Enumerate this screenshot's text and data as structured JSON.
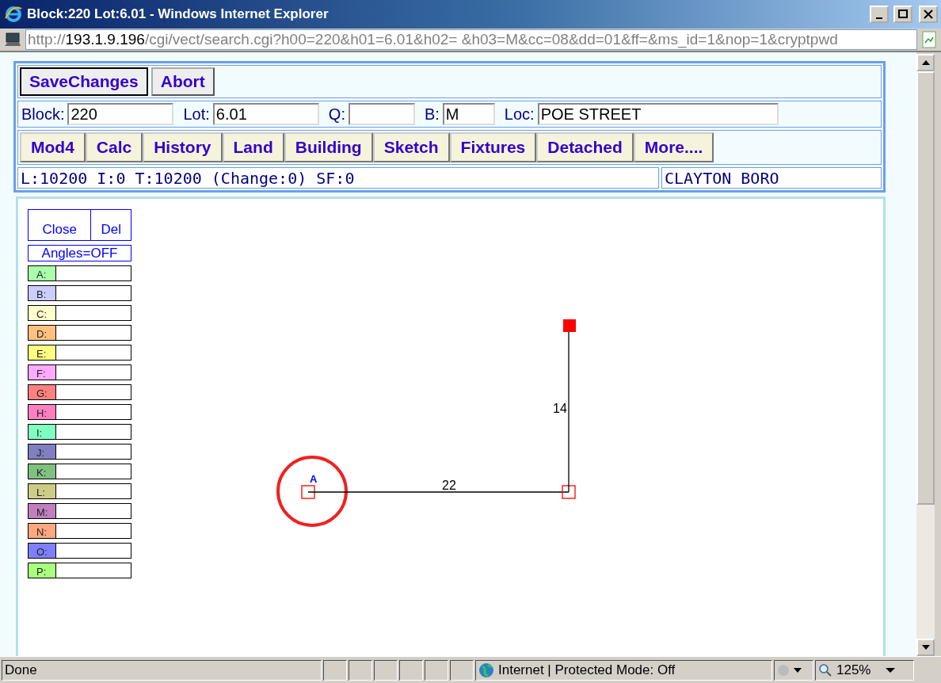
{
  "window": {
    "title": "Block:220 Lot:6.01 - Windows Internet Explorer"
  },
  "address_bar": {
    "scheme": "http://",
    "host": "193.1.9.196",
    "path": "/cgi/vect/search.cgi?h00=220&h01=6.01&h02= &h03=M&cc=08&dd=01&ff=&ms_id=1&nop=1&cryptpwd"
  },
  "action_buttons": [
    "SaveChanges",
    "Abort"
  ],
  "fields": [
    {
      "label": "Block:",
      "value": "220"
    },
    {
      "label": "Lot:",
      "value": "6.01"
    },
    {
      "label": "Q:"
    },
    {
      "label": "B:",
      "value": "M"
    },
    {
      "label": "Loc:",
      "value": "POE STREET"
    }
  ],
  "nav_buttons": [
    "Mod4",
    "Calc",
    "History",
    "Land",
    "Building",
    "Sketch",
    "Fixtures",
    "Detached",
    "More...."
  ],
  "summary": {
    "totals": "L:10200 I:0 T:10200 (Change:0) SF:0",
    "municipality": "CLAYTON BORO"
  },
  "sketch_tools": {
    "buttons": [
      "Close",
      "Del"
    ],
    "angles": "Angles=OFF"
  },
  "areas": [
    {
      "label": "A:",
      "color": "#aaffaa"
    },
    {
      "label": "B:",
      "color": "#ccccff"
    },
    {
      "label": "C:",
      "color": "#ffffcc"
    },
    {
      "label": "D:",
      "color": "#ffc080"
    },
    {
      "label": "E:",
      "color": "#ffff80"
    },
    {
      "label": "F:",
      "color": "#ffaaff"
    },
    {
      "label": "G:",
      "color": "#ff8080"
    },
    {
      "label": "H:",
      "color": "#ff80c0"
    },
    {
      "label": "I:",
      "color": "#80ffc0"
    },
    {
      "label": "J:",
      "color": "#8080c0"
    },
    {
      "label": "K:",
      "color": "#80c080"
    },
    {
      "label": "L:",
      "color": "#cccc88"
    },
    {
      "label": "M:",
      "color": "#c080c0"
    },
    {
      "label": "N:",
      "color": "#ffa880"
    },
    {
      "label": "O:",
      "color": "#8080ff"
    },
    {
      "label": "P:",
      "color": "#aaff80"
    }
  ],
  "sketch": {
    "start_label": "A",
    "segments": [
      {
        "length": "22"
      },
      {
        "length": "14"
      }
    ]
  },
  "status_bar": {
    "text": "Done",
    "zone": "Internet | Protected Mode: Off",
    "zoom": "125%"
  }
}
